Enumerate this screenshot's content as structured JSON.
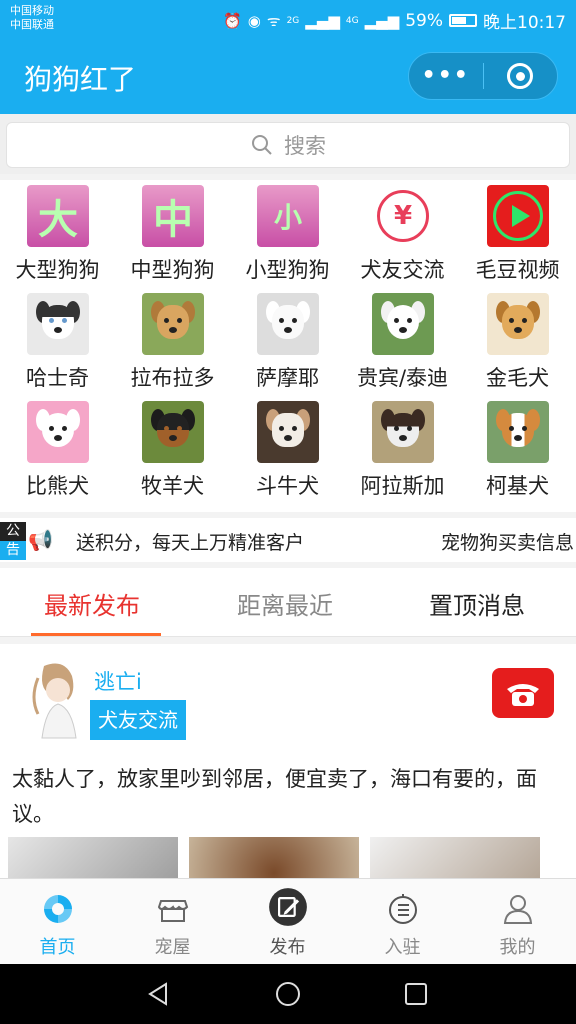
{
  "status_bar": {
    "carrier1": "中国移动",
    "carrier2": "中国联通",
    "net_2g": "2G",
    "net_4g": "4G",
    "battery": "59%",
    "time": "晚上10:17"
  },
  "app": {
    "title": "狗狗红了",
    "more_glyph": "•••"
  },
  "search": {
    "placeholder": "搜索"
  },
  "categories": [
    {
      "label": "大型狗狗",
      "glyph": "大",
      "icon": "large-dog-tile"
    },
    {
      "label": "中型狗狗",
      "glyph": "中",
      "icon": "medium-dog-tile"
    },
    {
      "label": "小型狗狗",
      "glyph": "小",
      "icon": "small-dog-tile"
    },
    {
      "label": "犬友交流",
      "glyph": "¥",
      "icon": "yen-exchange-icon"
    },
    {
      "label": "毛豆视频",
      "icon": "video-play-icon"
    },
    {
      "label": "哈士奇",
      "icon": "husky-photo"
    },
    {
      "label": "拉布拉多",
      "icon": "labrador-photo"
    },
    {
      "label": "萨摩耶",
      "icon": "samoyed-photo"
    },
    {
      "label": "贵宾/泰迪",
      "icon": "poodle-photo"
    },
    {
      "label": "金毛犬",
      "icon": "golden-retriever-photo"
    },
    {
      "label": "比熊犬",
      "icon": "bichon-photo"
    },
    {
      "label": "牧羊犬",
      "icon": "shepherd-photo"
    },
    {
      "label": "斗牛犬",
      "icon": "bulldog-photo"
    },
    {
      "label": "阿拉斯加",
      "icon": "alaskan-photo"
    },
    {
      "label": "柯基犬",
      "icon": "corgi-photo"
    }
  ],
  "notice": {
    "badge_top": "公",
    "badge_bottom": "告",
    "text": "送积分，每天上万精准客户",
    "text2": "宠物狗买卖信息"
  },
  "tabs": [
    {
      "label": "最新发布",
      "active": true
    },
    {
      "label": "距离最近",
      "active": false
    },
    {
      "label": "置顶消息",
      "active": false
    }
  ],
  "post": {
    "user": "逃亡i",
    "tag": "犬友交流",
    "text": "太黏人了，放家里吵到邻居，便宜卖了，海口有要的，面议。"
  },
  "tabbar": [
    {
      "label": "首页",
      "icon": "home-icon",
      "active": true
    },
    {
      "label": "宠屋",
      "icon": "shop-icon",
      "active": false
    },
    {
      "label": "发布",
      "icon": "edit-icon",
      "active": false
    },
    {
      "label": "入驻",
      "icon": "join-icon",
      "active": false
    },
    {
      "label": "我的",
      "icon": "profile-icon",
      "active": false
    }
  ],
  "colors": {
    "brand": "#1aaef0",
    "active_tab": "#e8332f",
    "tab_underline": "#ff6a2c",
    "phone": "#e51d1d"
  }
}
